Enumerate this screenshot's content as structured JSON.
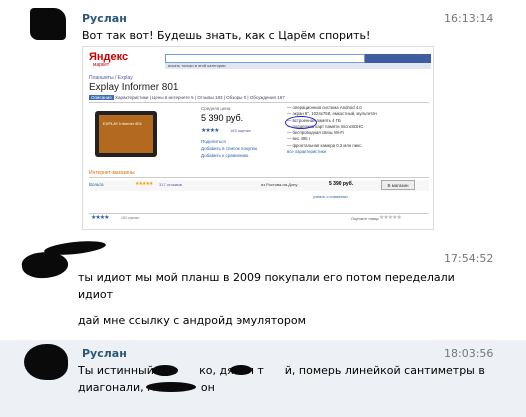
{
  "messages": [
    {
      "author": "Руслан",
      "time": "16:13:14",
      "lines": [
        "Вот так вот! Будешь знать, как с Царём спорить!"
      ]
    },
    {
      "author": "",
      "time": "17:54:52",
      "lines": [
        "ты идиот мы мой планш в 2009 покупали его потом переделали",
        "идиот",
        "дай мне ссылку с андройд эмулятором"
      ]
    },
    {
      "author": "Руслан",
      "time": "18:03:56",
      "lines": [
        "Ты истинный е          ко, дятел т      й, померь линейкой сантиметры в",
        "диагонали, м             он"
      ]
    }
  ],
  "screenshot": {
    "logo": "Яндекс",
    "logo_sub": "маркет",
    "search_bar_text": "искать только в этой категории",
    "breadcrumb": "Планшеты / Explay",
    "product_title": "Explay Informer 801",
    "tabs": {
      "active": "Описание",
      "rest": "Характеристики | Цены в интернете 5 | Отзывы 183 | Обзоры 0 | Обсуждения 167"
    },
    "image_label": "EXPLAY Informer 801",
    "price_label": "Средняя цена",
    "price": "5 390 руб.",
    "rating_stars": "★★★★",
    "reviews": "183 оценки",
    "links": [
      "Поделиться",
      "Добавить в список покупок",
      "Добавить к сравнению"
    ],
    "specs": [
      "— операционная система Android 4.0",
      "— экран 8\", 1024x768, емкостный, мультитач",
      "— встроенная память 4 ГБ",
      "— поддержка карт памяти microSDHC",
      "— беспроводная связь Wi-Fi",
      "— вес 495 г",
      "— фронтальная камера 0.3 млн пикс."
    ],
    "specs_link": "все характеристики",
    "shops_label": "Интернет-магазины",
    "shop": {
      "name": "Вольта",
      "stars": "★★★★★",
      "reviews": "317 отзывов",
      "city": "из Ростова-на-Дону",
      "price": "5 390 руб.",
      "button": "В магазин"
    },
    "all_offers": "узнать о снижении",
    "footer_stars": "★★★★",
    "footer_rating": "183 оценки",
    "footer_mark": "Оцените товар",
    "footer_grey": "★★★★★"
  }
}
